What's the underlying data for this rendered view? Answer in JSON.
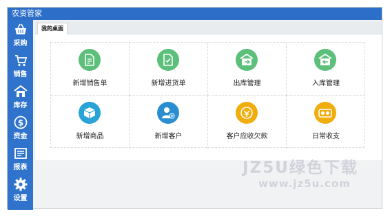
{
  "window": {
    "title": "农资管家"
  },
  "sidebar": {
    "items": [
      {
        "label": "采购",
        "icon": "basket-icon"
      },
      {
        "label": "销售",
        "icon": "cart-icon"
      },
      {
        "label": "库存",
        "icon": "warehouse-icon"
      },
      {
        "label": "资金",
        "icon": "dollar-coin-icon"
      },
      {
        "label": "报表",
        "icon": "report-icon"
      },
      {
        "label": "设置",
        "icon": "gear-icon"
      }
    ]
  },
  "tabs": [
    {
      "label": "我的桌面"
    }
  ],
  "desktop": {
    "shortcuts": [
      {
        "label": "新增销售单",
        "icon": "sales-document-icon",
        "color": "#5cbf7a"
      },
      {
        "label": "新增进货单",
        "icon": "purchase-document-icon",
        "color": "#5cbf7a"
      },
      {
        "label": "出库管理",
        "icon": "warehouse-out-icon",
        "color": "#5cbf7a"
      },
      {
        "label": "入库管理",
        "icon": "warehouse-in-icon",
        "color": "#5cbf7a"
      },
      {
        "label": "新增商品",
        "icon": "product-box-icon",
        "color": "#2aa3d8"
      },
      {
        "label": "新增客户",
        "icon": "add-customer-icon",
        "color": "#2a8fd0"
      },
      {
        "label": "客户应收欠款",
        "icon": "receivable-icon",
        "color": "#f0ad0b"
      },
      {
        "label": "日常收支",
        "icon": "income-expense-icon",
        "color": "#f0ad0b"
      }
    ]
  },
  "colors": {
    "titlebar": "#2d6fc8",
    "sidebar": "#2f73cc",
    "background": "#f1f2f4"
  },
  "watermark": {
    "line1": "JZ5U绿色下载",
    "line2": "www.jz5u.com"
  }
}
